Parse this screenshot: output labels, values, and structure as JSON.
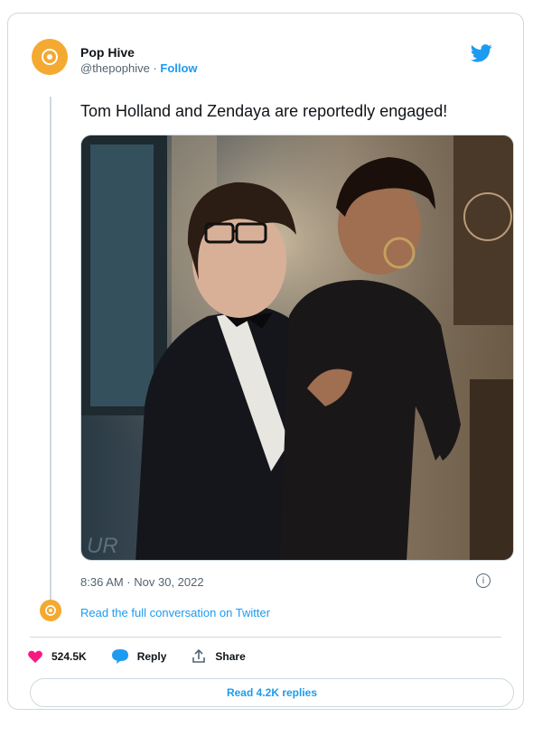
{
  "tweet": {
    "author_name": "Pop Hive",
    "author_handle": "@thepophive",
    "separator": " · ",
    "follow_label": "Follow",
    "text": "Tom Holland and Zendaya are reportedly engaged!",
    "timestamp": "8:36 AM · Nov 30, 2022",
    "read_full_label": "Read the full conversation on Twitter",
    "likes_count": "524.5K",
    "reply_label": "Reply",
    "share_label": "Share",
    "read_replies_label": "Read 4.2K replies",
    "info_glyph": "i"
  },
  "icons": {
    "brand": "twitter-bird-icon",
    "like": "heart-icon",
    "reply": "speech-bubble-icon",
    "share": "share-icon",
    "info": "info-icon"
  },
  "colors": {
    "accent": "#1d9bf0",
    "avatar": "#f4a931",
    "like": "#f91880",
    "muted": "#536471",
    "border": "#cfd9de"
  }
}
